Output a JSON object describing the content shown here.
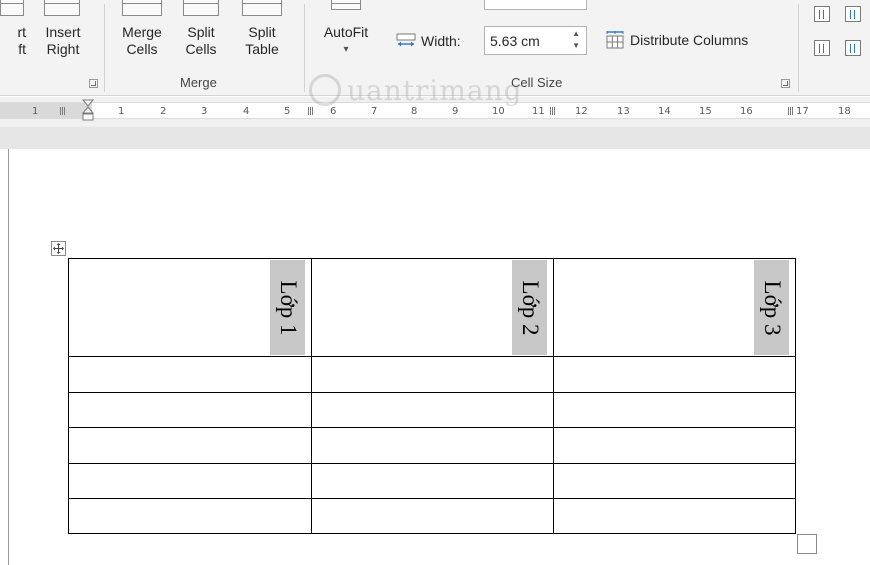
{
  "ribbon": {
    "insert_left_partial": {
      "line1": "rt",
      "line2": "ft"
    },
    "insert_right": {
      "line1": "Insert",
      "line2": "Right"
    },
    "merge_cells": {
      "line1": "Merge",
      "line2": "Cells"
    },
    "split_cells": {
      "line1": "Split",
      "line2": "Cells"
    },
    "split_table": {
      "line1": "Split",
      "line2": "Table"
    },
    "autofit": {
      "label": "AutoFit",
      "arrow": "▾"
    },
    "width_label": "Width:",
    "width_value": "5.63 cm",
    "distribute_columns": "Distribute Columns",
    "groups": {
      "merge": "Merge",
      "cell_size": "Cell Size"
    }
  },
  "ruler": {
    "numbers": [
      "1",
      "1",
      "2",
      "3",
      "4",
      "5",
      "6",
      "7",
      "8",
      "9",
      "10",
      "11",
      "12",
      "13",
      "14",
      "15",
      "16",
      "17",
      "18"
    ]
  },
  "watermark": {
    "text": "uantrimang"
  },
  "table": {
    "headers": [
      "Lớp 1",
      "Lớp 2",
      "Lớp 3"
    ],
    "empty_rows": 5
  },
  "colors": {
    "accent": "#2b78c5",
    "ribbon_bg": "#f3f3f3",
    "header_shading": "#c8c8c8"
  }
}
